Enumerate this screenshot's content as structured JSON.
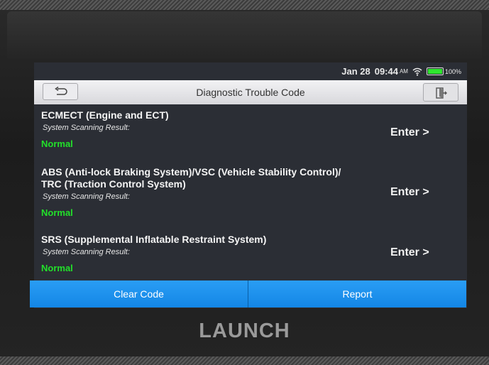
{
  "status_bar": {
    "date": "Jan 28",
    "time": "09:44",
    "ampm": "AM",
    "battery": "100%",
    "battery_color": "#2ee62e"
  },
  "title_bar": {
    "title": "Diagnostic Trouble Code",
    "back_icon": "back-arrow-icon",
    "exit_icon": "exit-icon"
  },
  "systems": [
    {
      "name_lines": [
        "ECMECT (Engine and ECT)"
      ],
      "scan_label": "System Scanning Result:",
      "result": "Normal",
      "enter_label": "Enter >"
    },
    {
      "name_lines": [
        "ABS (Anti-lock Braking System)/VSC (Vehicle Stability Control)/",
        "TRC (Traction Control System)"
      ],
      "scan_label": "System Scanning Result:",
      "result": "Normal",
      "enter_label": "Enter >"
    },
    {
      "name_lines": [
        "SRS (Supplemental Inflatable Restraint System)"
      ],
      "scan_label": "System Scanning Result:",
      "result": "Normal",
      "enter_label": "Enter >"
    }
  ],
  "actions": {
    "clear_code": "Clear Code",
    "report": "Report",
    "accent": "#1a8ff0"
  },
  "brand": "LAUNCH",
  "colors": {
    "normal_status": "#22e02a"
  }
}
